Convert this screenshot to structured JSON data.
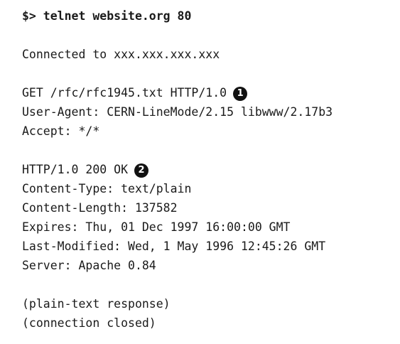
{
  "command": "$> telnet website.org 80",
  "connected": "Connected to xxx.xxx.xxx.xxx",
  "request": {
    "line": "GET /rfc/rfc1945.txt HTTP/1.0",
    "callout": "1",
    "headers": [
      "User-Agent: CERN-LineMode/2.15 libwww/2.17b3",
      "Accept: */*"
    ]
  },
  "response": {
    "line": "HTTP/1.0 200 OK",
    "callout": "2",
    "headers": [
      "Content-Type: text/plain",
      "Content-Length: 137582",
      "Expires: Thu, 01 Dec 1997 16:00:00 GMT",
      "Last-Modified: Wed, 1 May 1996 12:45:26 GMT",
      "Server: Apache 0.84"
    ]
  },
  "notes": [
    "(plain-text response)",
    "(connection closed)"
  ]
}
